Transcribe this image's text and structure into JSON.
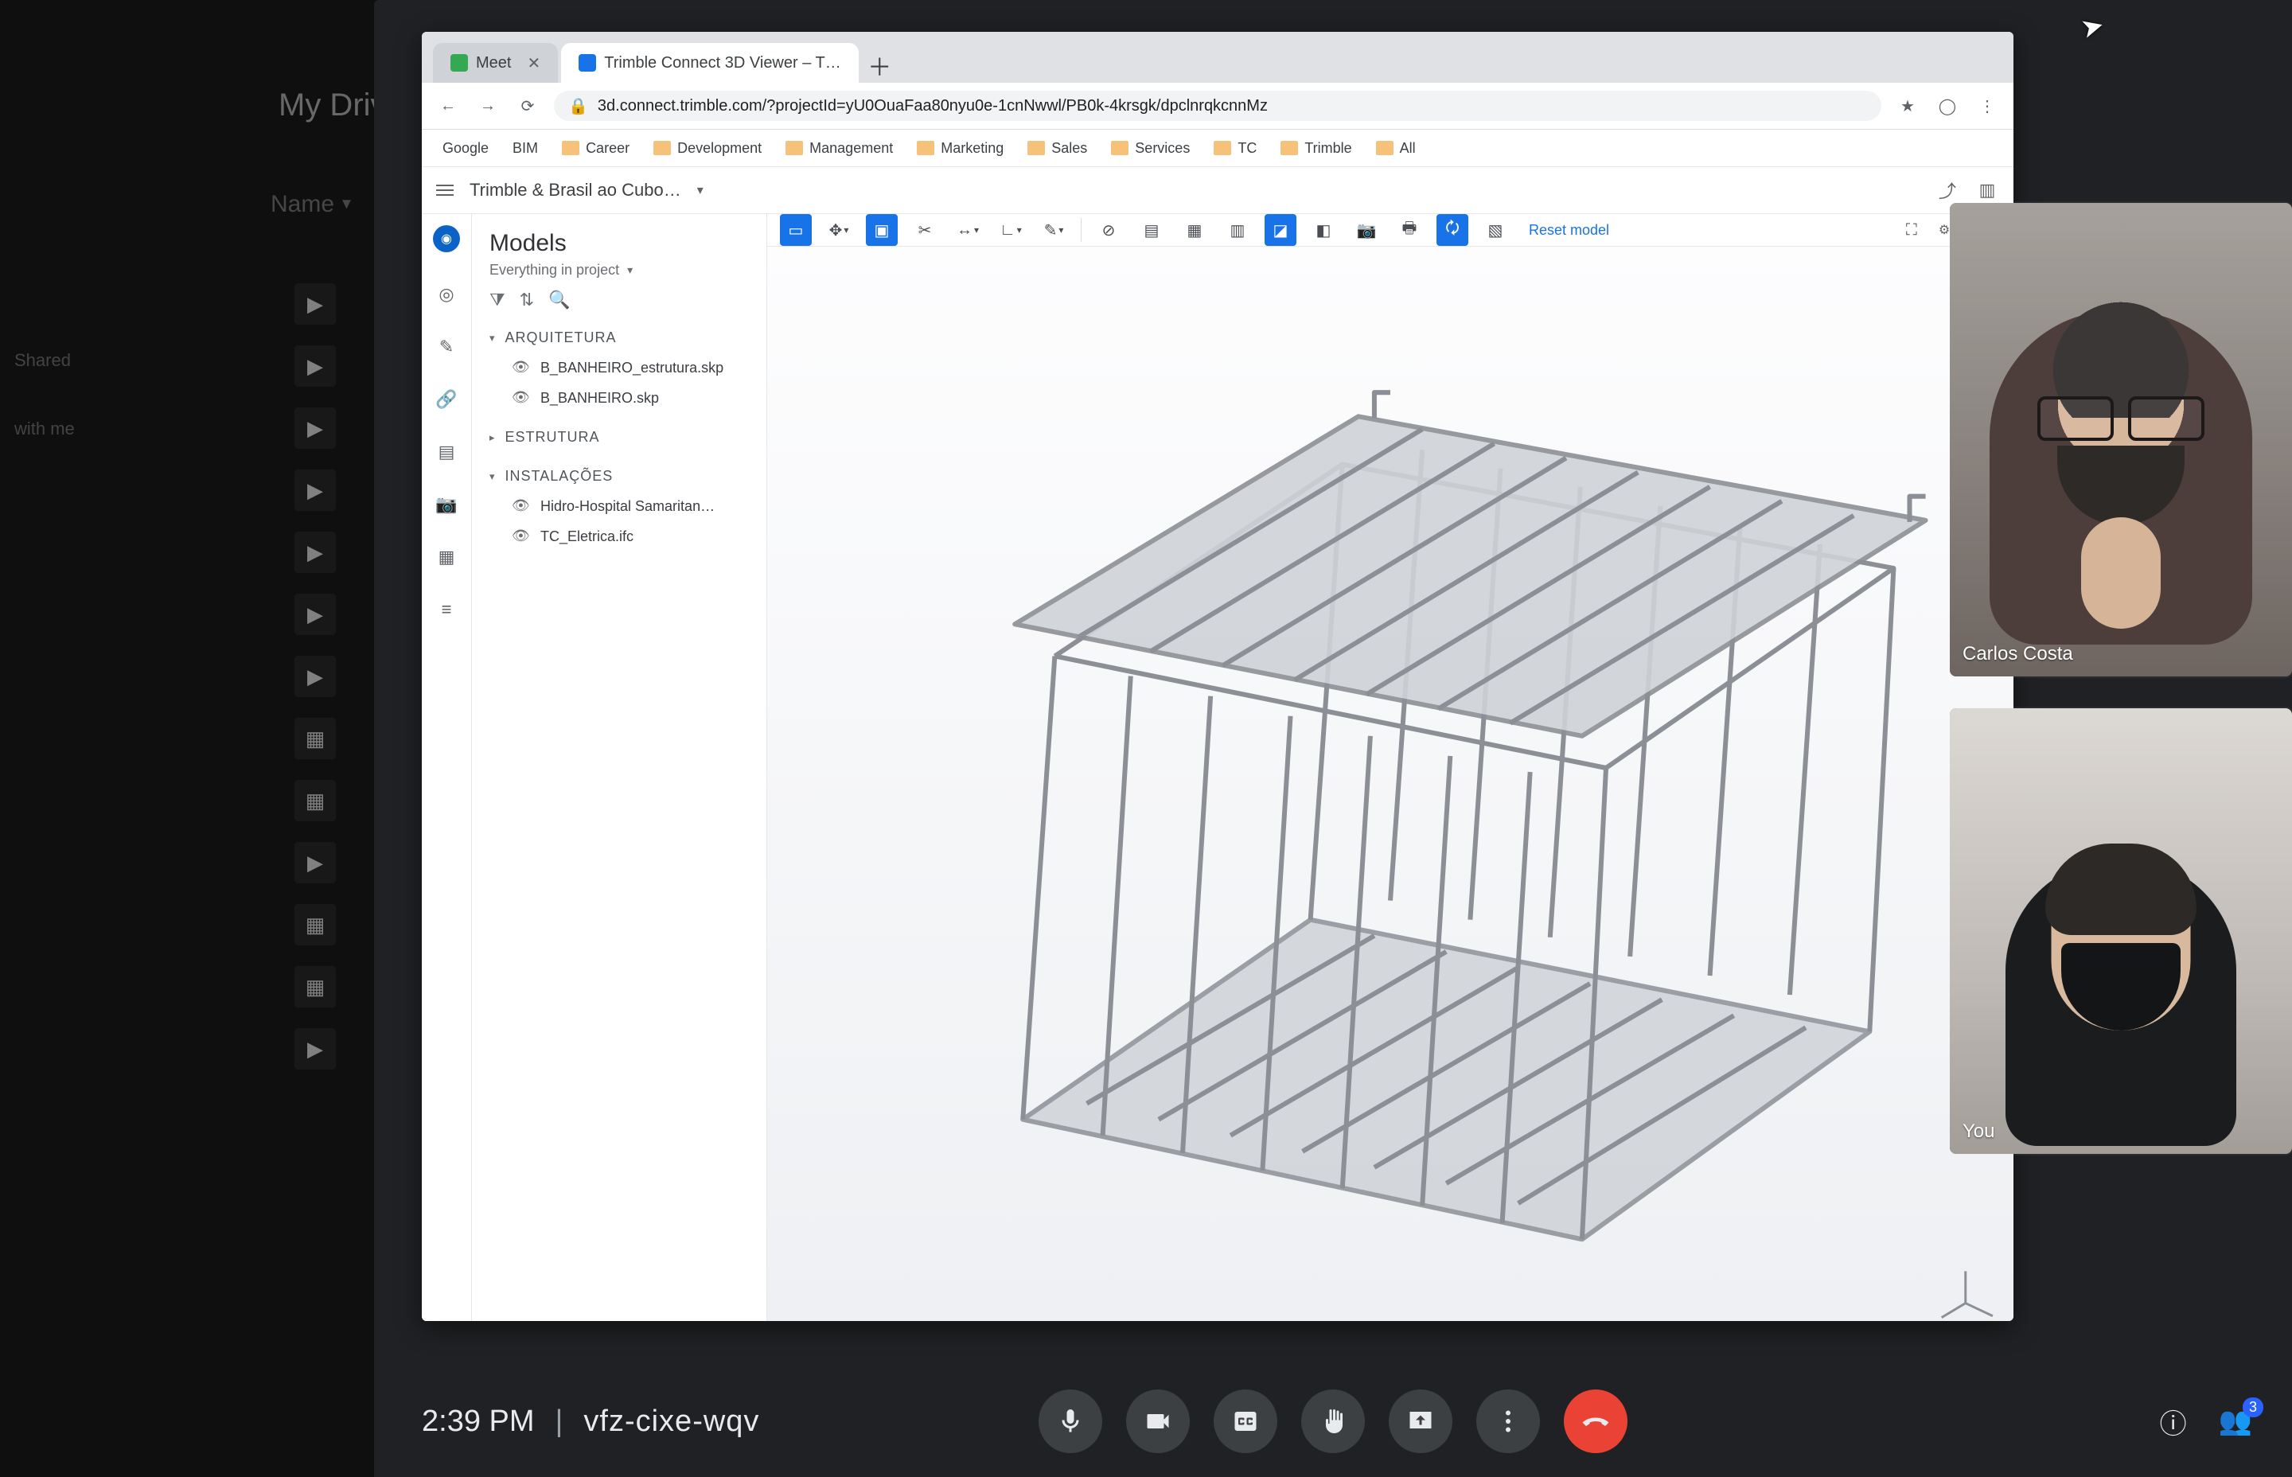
{
  "drive": {
    "heading": "My Drive",
    "columnsLabel": "Name",
    "sidebar": {
      "shared": "Shared",
      "withMe": "with me"
    }
  },
  "chrome": {
    "tabs": [
      {
        "label": "Meet",
        "active": false
      },
      {
        "label": "Trimble Connect 3D Viewer – T…",
        "active": true
      }
    ],
    "url": "3d.connect.trimble.com/?projectId=yU0OuaFaa80nyu0e-1cnNwwl/PB0k-4krsgk/dpclnrqkcnnMz",
    "bookmarks": [
      "Google",
      "BIM",
      "Career",
      "Development",
      "Management",
      "Marketing",
      "Sales",
      "Services",
      "TC",
      "Trimble",
      "All"
    ]
  },
  "app": {
    "projectName": "Trimble & Brasil ao Cubo…",
    "panel": {
      "title": "Models",
      "scope": "Everything in project",
      "groups": [
        {
          "label": "ARQUITETURA",
          "items": [
            "B_BANHEIRO_estrutura.skp",
            "B_BANHEIRO.skp"
          ]
        },
        {
          "label": "ESTRUTURA",
          "items": []
        },
        {
          "label": "INSTALAÇÕES",
          "items": [
            "Hidro-Hospital Samaritan…",
            "TC_Eletrica.ifc"
          ]
        }
      ]
    },
    "resetLabel": "Reset model",
    "settingsLabel": "Settings"
  },
  "meet": {
    "time": "2:39 PM",
    "code": "vfz-cixe-wqv",
    "tiles": [
      {
        "name": "Carlos Costa"
      },
      {
        "name": "You"
      }
    ],
    "peopleCount": "3"
  }
}
